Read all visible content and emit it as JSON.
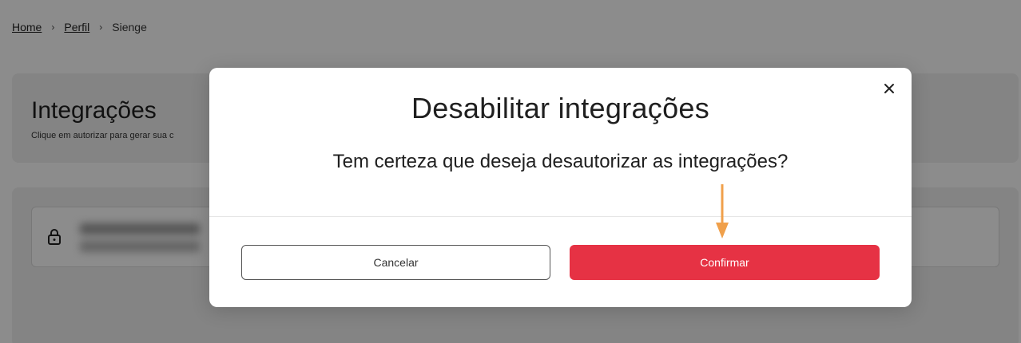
{
  "breadcrumb": {
    "home": "Home",
    "perfil": "Perfil",
    "current": "Sienge",
    "separator": "›"
  },
  "header": {
    "title": "Integrações",
    "subtitle": "Clique em autorizar para gerar sua c"
  },
  "integration_item": {
    "icon": "lock-icon"
  },
  "modal": {
    "title": "Desabilitar integrações",
    "message": "Tem certeza que deseja desautorizar as integrações?",
    "cancel_label": "Cancelar",
    "confirm_label": "Confirmar",
    "close_icon": "close-icon",
    "annotation_icon": "arrow-down-icon"
  },
  "colors": {
    "confirm": "#e63244",
    "arrow": "#f0a04b",
    "overlay": "rgba(0,0,0,0.45)"
  }
}
